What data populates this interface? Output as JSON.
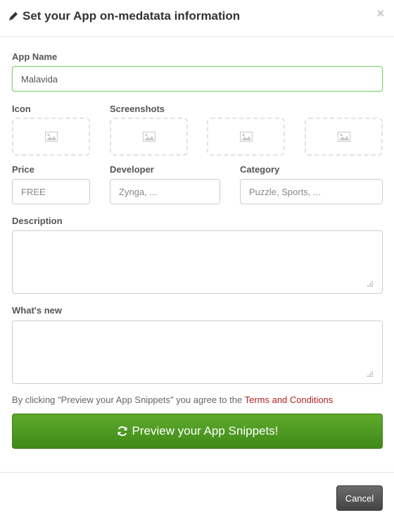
{
  "dialog": {
    "title": "Set your App on-medatata information",
    "title_icon": "pencil-icon",
    "close_label": "×"
  },
  "form": {
    "app_name": {
      "label": "App Name",
      "value": "Malavida"
    },
    "icon": {
      "label": "Icon"
    },
    "screenshots": {
      "label": "Screenshots",
      "slots": 3
    },
    "price": {
      "label": "Price",
      "placeholder": "FREE"
    },
    "developer": {
      "label": "Developer",
      "placeholder": "Zynga, ..."
    },
    "category": {
      "label": "Category",
      "placeholder": "Puzzle, Sports, ..."
    },
    "description": {
      "label": "Description",
      "value": ""
    },
    "whats_new": {
      "label": "What's new",
      "value": ""
    }
  },
  "terms": {
    "prefix": "By clicking \"Preview your App Snippets\" you agree to the ",
    "link": "Terms and Conditions"
  },
  "actions": {
    "preview_label": "Preview your App Snippets!",
    "preview_icon": "refresh-icon",
    "cancel_label": "Cancel"
  },
  "colors": {
    "primary_green": "#4f9a22",
    "focus_border": "#7ed66e",
    "terms_link": "#b22222",
    "cancel_dark": "#555555"
  }
}
